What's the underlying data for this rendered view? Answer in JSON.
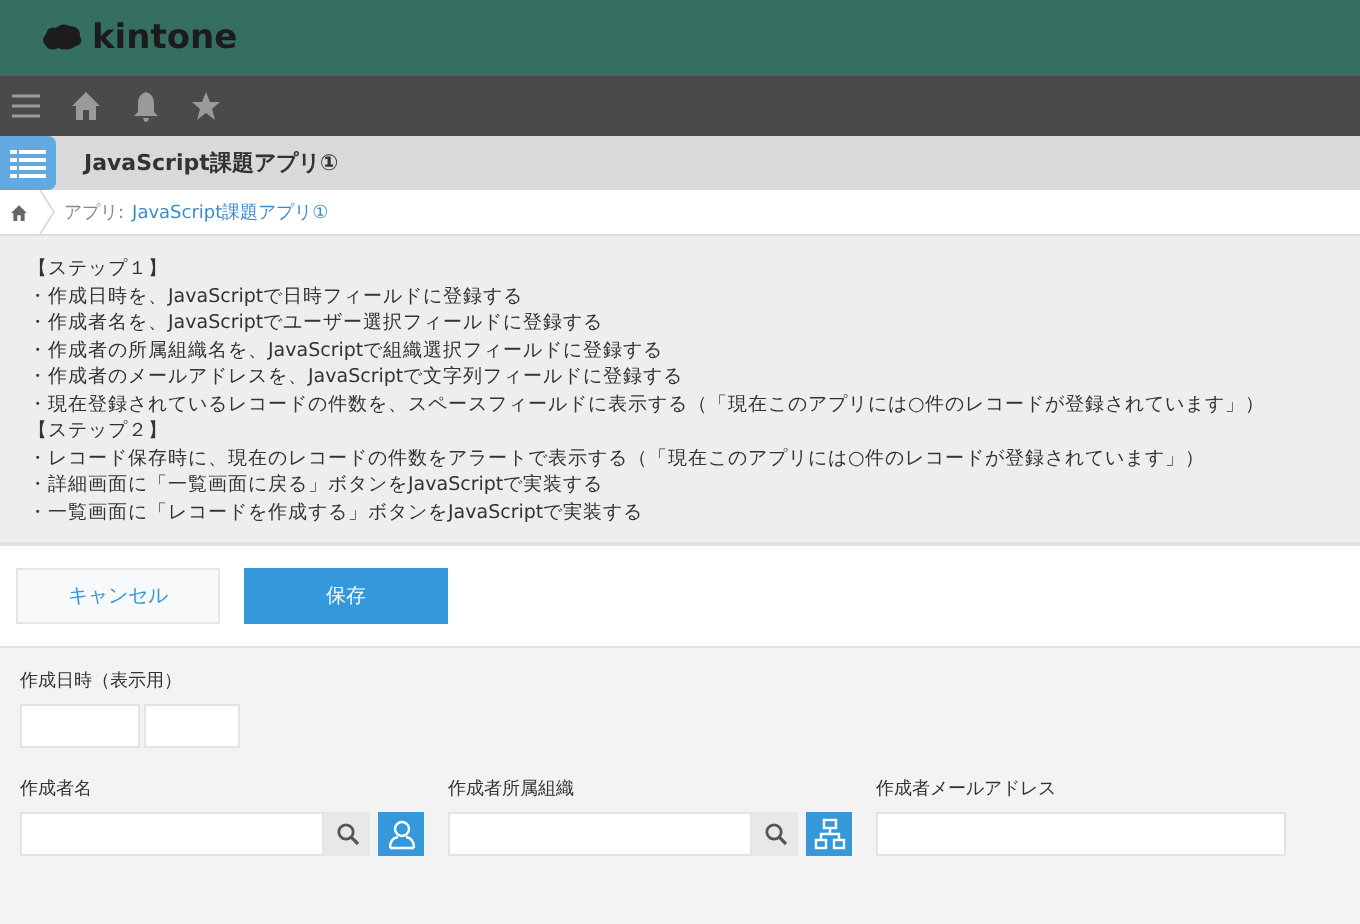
{
  "header": {
    "logo": "kintone"
  },
  "app": {
    "title": "JavaScript課題アプリ①"
  },
  "breadcrumb": {
    "prefix": "アプリ:",
    "link": "JavaScript課題アプリ①"
  },
  "description": [
    "【ステップ１】",
    "・作成日時を、JavaScriptで日時フィールドに登録する",
    "・作成者名を、JavaScriptでユーザー選択フィールドに登録する",
    "・作成者の所属組織名を、JavaScriptで組織選択フィールドに登録する",
    "・作成者のメールアドレスを、JavaScriptで文字列フィールドに登録する",
    "・現在登録されているレコードの件数を、スペースフィールドに表示する（「現在このアプリには○件のレコードが登録されています」）",
    "【ステップ２】",
    "・レコード保存時に、現在のレコードの件数をアラートで表示する（「現在このアプリには○件のレコードが登録されています」）",
    "・詳細画面に「一覧画面に戻る」ボタンをJavaScriptで実装する",
    "・一覧画面に「レコードを作成する」ボタンをJavaScriptで実装する"
  ],
  "buttons": {
    "cancel": "キャンセル",
    "save": "保存"
  },
  "field_rows": [
    [
      {
        "kind": "datetime",
        "label": "作成日時（表示用）"
      }
    ],
    [
      {
        "kind": "user",
        "label": "作成者名"
      },
      {
        "kind": "org",
        "label": "作成者所属組織"
      },
      {
        "kind": "text",
        "label": "作成者メールアドレス"
      }
    ]
  ]
}
